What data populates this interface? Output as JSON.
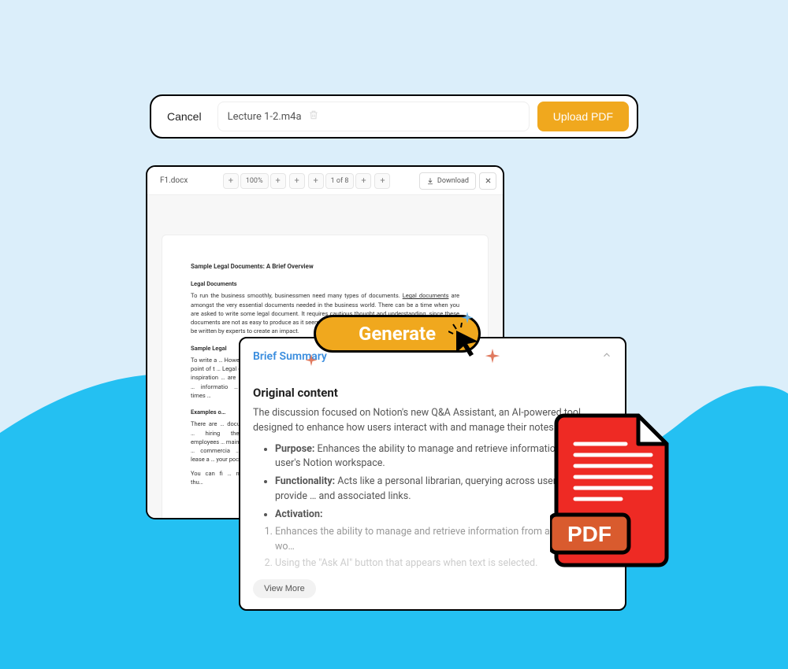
{
  "upload_bar": {
    "cancel": "Cancel",
    "filename": "Lecture 1-2.m4a",
    "upload_btn": "Upload PDF"
  },
  "viewer": {
    "filename": "F1.docx",
    "zoom": "100%",
    "page_info": "1 of 8",
    "download": "Download",
    "doc": {
      "title": "Sample Legal Documents: A Brief Overview",
      "h1": "Legal Documents",
      "p1a": "To run the business smoothly, businessmen need many types of documents. ",
      "p1_link": "Legal documents",
      "p1b": " are amongst the very essential documents needed in the business world. There can be a time when you are asked to write some legal document. It requires cautious thought and understanding, since these documents are not as easy to produce as it seems. ",
      "p1c": "be written by experts to create an impact.",
      "h2": "Sample Legal",
      "p2": "To write a … However, … point of t … Legal doc … inspiration … are availa … informatio … two times …",
      "h3": "Examples o…",
      "p3": "There are … document … hiring the … employees … maintain a … commercia … the lease a … your pocke…",
      "p4": "You can fi … money thu…"
    }
  },
  "generate": "Generate",
  "summary": {
    "header": "Brief Summary",
    "section": "Original content",
    "intro": "The discussion focused on Notion's new Q&A Assistant, an AI-powered tool designed to enhance how users interact with and manage their notes.",
    "bullets": [
      {
        "label": "Purpose:",
        "text": " Enhances the ability to manage and retrieve information from a user's Notion workspace."
      },
      {
        "label": "Functionality:",
        "text": " Acts like a personal librarian, querying across user's notes to provide … and associated links."
      },
      {
        "label": "Activation:",
        "text": ""
      }
    ],
    "activation_list": [
      "Enhances the ability to manage and retrieve information from a user's Notion wo…",
      "Using the \"Ask AI\" button that appears when text is selected."
    ],
    "view_more": "View More"
  },
  "pdf_label": "PDF"
}
